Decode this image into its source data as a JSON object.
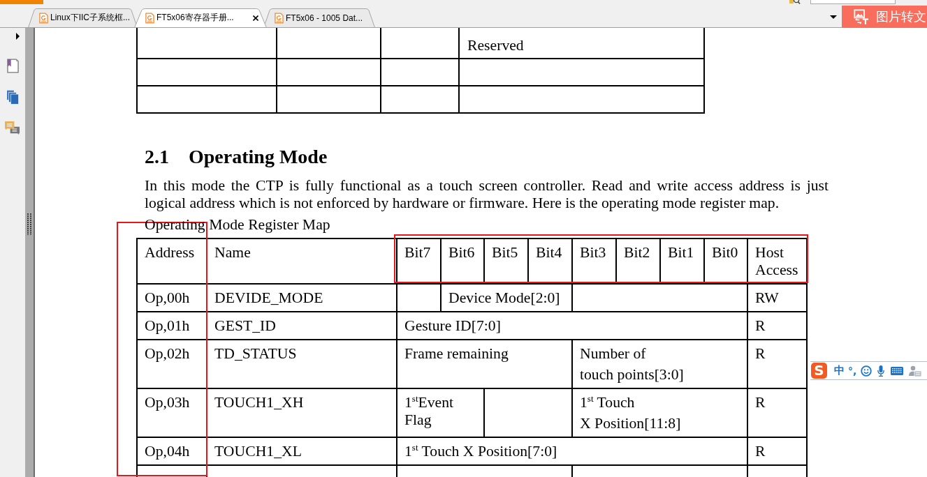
{
  "tabs": [
    {
      "label": "Linux下IIC子系统框...",
      "selected": false
    },
    {
      "label": "FT5x06寄存器手册...",
      "selected": true
    },
    {
      "label": "FT5x06 - 1005 Dat...",
      "selected": false
    }
  ],
  "convert_button": {
    "label": "图片转文"
  },
  "document": {
    "top_table": {
      "cell_text": "Reserved"
    },
    "section": {
      "number": "2.1",
      "title": "Operating Mode"
    },
    "paragraph": "In this mode the CTP is fully functional as a touch screen controller. Read and write access address is just logical address which is not enforced by hardware or firmware. Here is the operating mode register map.",
    "table_caption": "Operating Mode Register Map",
    "register_table": {
      "columns": [
        "Address",
        "Name",
        "Bit7",
        "Bit6",
        "Bit5",
        "Bit4",
        "Bit3",
        "Bit2",
        "Bit1",
        "Bit0",
        "Host Access"
      ],
      "rows": [
        {
          "address": "Op,00h",
          "name": "DEVIDE_MODE",
          "fields": [
            {
              "kind": "blank"
            },
            {
              "kind": "text",
              "text": "Device Mode[2:0]"
            },
            {
              "kind": "blank"
            }
          ],
          "access": "RW"
        },
        {
          "address": "Op,01h",
          "name": "GEST_ID",
          "fields": [
            {
              "kind": "text",
              "text": "Gesture ID[7:0]"
            }
          ],
          "access": "R"
        },
        {
          "address": "Op,02h",
          "name": "TD_STATUS",
          "fields": [
            {
              "kind": "text",
              "text": "Frame remaining"
            },
            {
              "kind": "lines",
              "lines": [
                "Number of",
                "touch points[3:0]"
              ]
            }
          ],
          "access": "R"
        },
        {
          "address": "Op,03h",
          "name": "TOUCH1_XH",
          "fields": [
            {
              "kind": "text",
              "text": "1$^{st}$Event Flag"
            },
            {
              "kind": "blank"
            },
            {
              "kind": "lines",
              "lines": [
                "1$^{st}$ Touch",
                "X Position[11:8]"
              ]
            }
          ],
          "access": "R"
        },
        {
          "address": "Op,04h",
          "name": "TOUCH1_XL",
          "fields": [
            {
              "kind": "text",
              "text": "1$^{st}$ Touch X Position[7:0]"
            }
          ],
          "access": "R"
        }
      ]
    },
    "annotations": {
      "address_column_boxed": true,
      "bit_headers_boxed": true
    }
  },
  "ime_toolbar": {
    "logo": "S",
    "mode": "中",
    "punctuation": "°,"
  }
}
